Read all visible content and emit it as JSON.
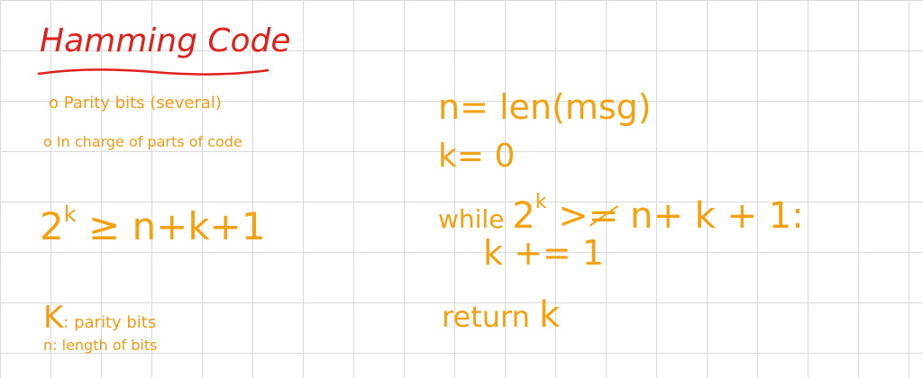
{
  "title": "Hamming Code",
  "notes": {
    "bullet_1": "o Parity bits (several)",
    "bullet_2": "o In charge of parts of code",
    "formula_base": "2",
    "formula_exp": "k",
    "formula_rest": " ≥ n+k+1",
    "def_k_var": "K",
    "def_k_text": ": parity bits",
    "def_n": "n: length of bits"
  },
  "code": {
    "line_1": "n= len(msg)",
    "line_2": "k= 0",
    "line_3_kw": "while ",
    "line_3_base": "2",
    "line_3_exp": "k",
    "line_3_op": " >",
    "line_3_struck": "=",
    "line_3_rest": " n+ k + 1:",
    "line_4": "k += 1",
    "line_5_kw": "return ",
    "line_5_var": "k"
  },
  "colors": {
    "title": "#e0201b",
    "ink": "#f5a10f",
    "grid": "#d9d9d9",
    "background": "#ffffff"
  }
}
